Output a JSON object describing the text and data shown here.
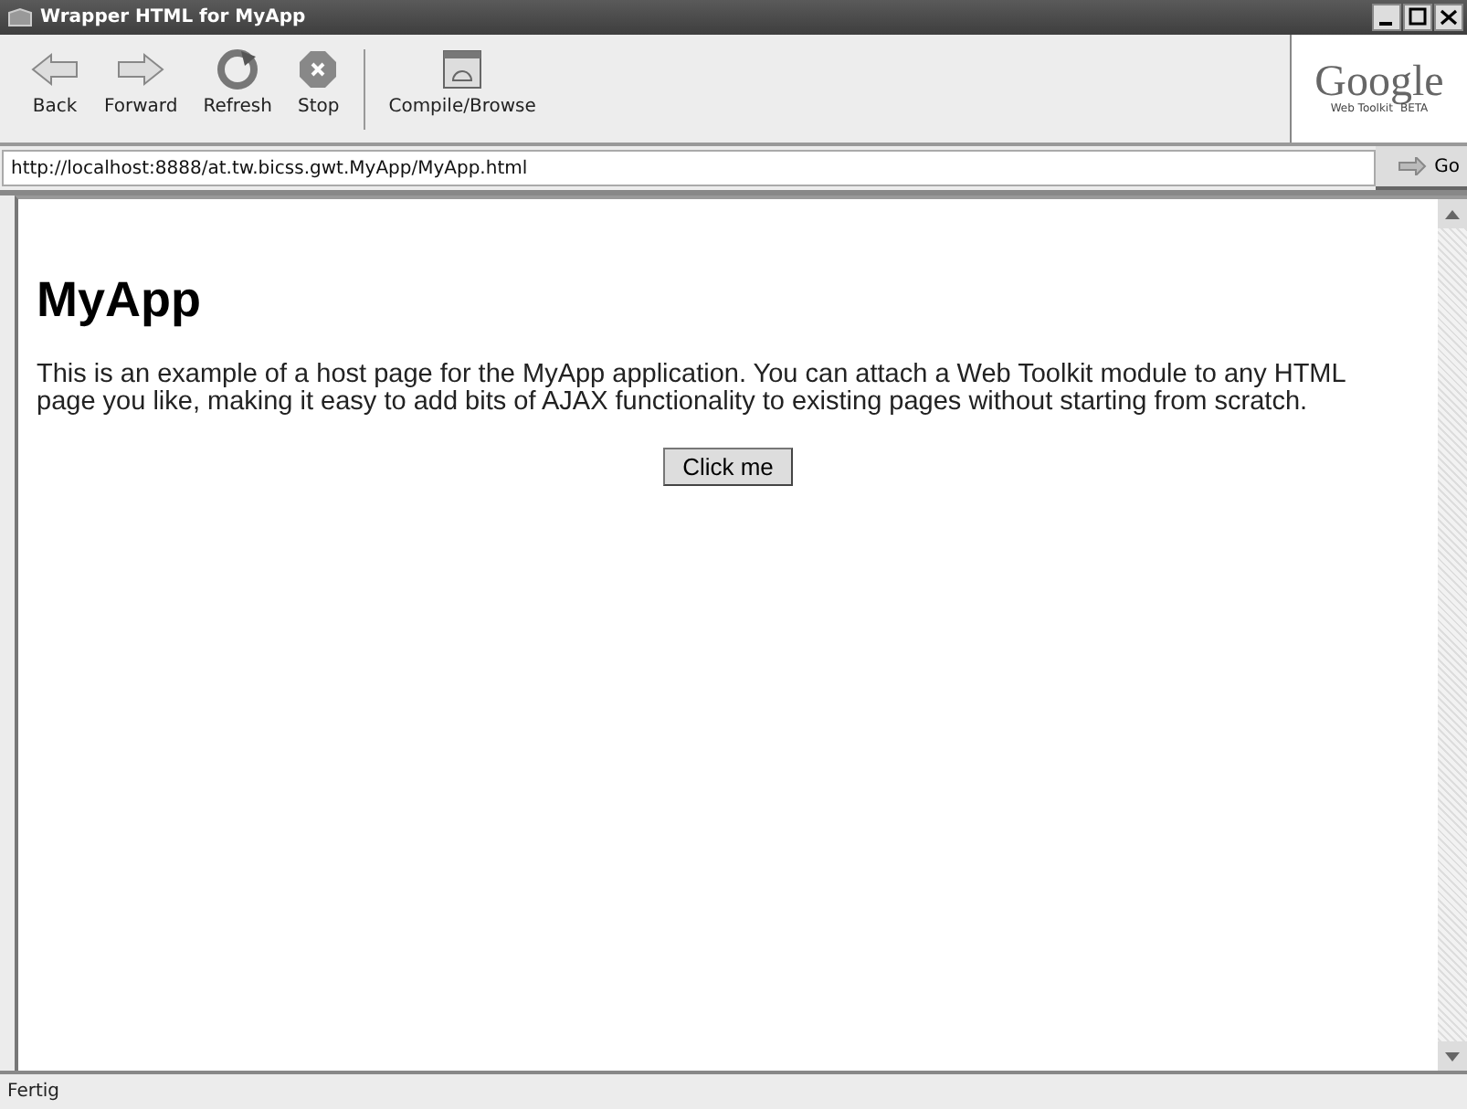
{
  "window": {
    "title": "Wrapper HTML for MyApp"
  },
  "toolbar": {
    "buttons": [
      {
        "kind": "back",
        "label": "Back"
      },
      {
        "kind": "forward",
        "label": "Forward"
      },
      {
        "kind": "refresh",
        "label": "Refresh"
      },
      {
        "kind": "stop",
        "label": "Stop"
      },
      {
        "kind": "compile",
        "label": "Compile/Browse"
      }
    ],
    "logo": {
      "name": "Google",
      "subtitle": "Web Toolkit",
      "badge": "BETA"
    }
  },
  "address_bar": {
    "value": "http://localhost:8888/at.tw.bicss.gwt.MyApp/MyApp.html",
    "go_label": "Go"
  },
  "page": {
    "heading": "MyApp",
    "paragraph": "This is an example of a host page for the MyApp application. You can attach a Web Toolkit module to any HTML page you like, making it easy to add bits of AJAX functionality to existing pages without starting from scratch.",
    "button": "Click me"
  },
  "status_bar": {
    "text": "Fertig"
  }
}
